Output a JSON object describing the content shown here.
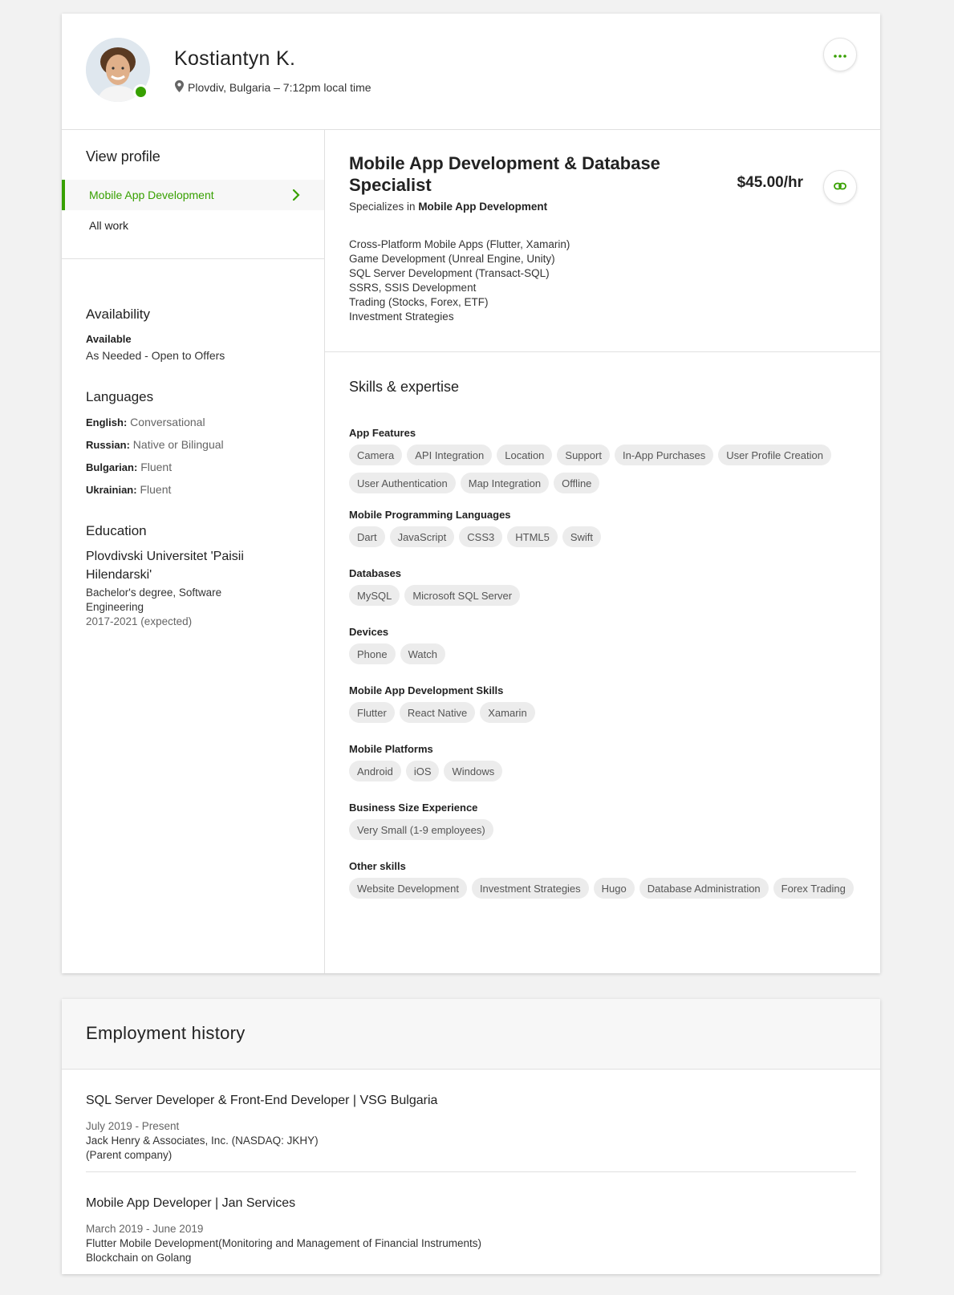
{
  "profile": {
    "name": "Kostiantyn K.",
    "location": "Plovdiv, Bulgaria – 7:12pm local time"
  },
  "nav": {
    "heading": "View profile",
    "items": [
      {
        "label": "Mobile App Development"
      },
      {
        "label": "All work"
      }
    ]
  },
  "availability": {
    "heading": "Availability",
    "status": "Available",
    "detail": "As Needed - Open to Offers"
  },
  "languages": {
    "heading": "Languages",
    "items": [
      {
        "name": "English:",
        "level": "Conversational"
      },
      {
        "name": "Russian:",
        "level": "Native or Bilingual"
      },
      {
        "name": "Bulgarian:",
        "level": "Fluent"
      },
      {
        "name": "Ukrainian:",
        "level": "Fluent"
      }
    ]
  },
  "education": {
    "heading": "Education",
    "school": "Plovdivski Universitet 'Paisii Hilendarski'",
    "degree": "Bachelor's degree, Software Engineering",
    "years": "2017-2021 (expected)"
  },
  "specialization": {
    "title": "Mobile App Development & Database Specialist",
    "specializes_prefix": "Specializes in",
    "specializes_value": "Mobile App Development",
    "rate": "$45.00/hr",
    "description": [
      "Cross-Platform Mobile Apps (Flutter, Xamarin)",
      "Game Development (Unreal Engine, Unity)",
      "SQL Server Development (Transact-SQL)",
      "SSRS, SSIS Development",
      "Trading (Stocks, Forex, ETF)",
      "Investment Strategies"
    ]
  },
  "skills": {
    "heading": "Skills & expertise",
    "groups": [
      {
        "title": "App Features",
        "chips": [
          "Camera",
          "API Integration",
          "Location",
          "Support",
          "In-App Purchases",
          "User Profile Creation",
          "User Authentication",
          "Map Integration",
          "Offline"
        ]
      },
      {
        "title": "Mobile Programming Languages",
        "chips": [
          "Dart",
          "JavaScript",
          "CSS3",
          "HTML5",
          "Swift"
        ]
      },
      {
        "title": "Databases",
        "chips": [
          "MySQL",
          "Microsoft SQL Server"
        ]
      },
      {
        "title": "Devices",
        "chips": [
          "Phone",
          "Watch"
        ]
      },
      {
        "title": "Mobile App Development Skills",
        "chips": [
          "Flutter",
          "React Native",
          "Xamarin"
        ]
      },
      {
        "title": "Mobile Platforms",
        "chips": [
          "Android",
          "iOS",
          "Windows"
        ]
      },
      {
        "title": "Business Size Experience",
        "chips": [
          "Very Small (1-9 employees)"
        ]
      },
      {
        "title": "Other skills",
        "chips": [
          "Website Development",
          "Investment Strategies",
          "Hugo",
          "Database Administration",
          "Forex Trading"
        ]
      }
    ]
  },
  "employment": {
    "heading": "Employment history",
    "jobs": [
      {
        "title": "SQL Server Developer & Front-End Developer | VSG Bulgaria",
        "dates": "July 2019 - Present",
        "lines": [
          "Jack Henry & Associates, Inc. (NASDAQ: JKHY)",
          "(Parent company)"
        ]
      },
      {
        "title": "Mobile App Developer | Jan Services",
        "dates": "March 2019 - June 2019",
        "lines": [
          "Flutter Mobile Development(Monitoring and Management of Financial Instruments)",
          "Blockchain on Golang"
        ]
      }
    ]
  },
  "colors": {
    "accent": "#37a000",
    "chip_bg": "#ececec",
    "page_bg": "#f2f2f2"
  },
  "icons": {
    "more": "ellipsis-icon",
    "link": "link-icon",
    "location": "map-pin-icon",
    "chevron": "chevron-right-icon"
  }
}
